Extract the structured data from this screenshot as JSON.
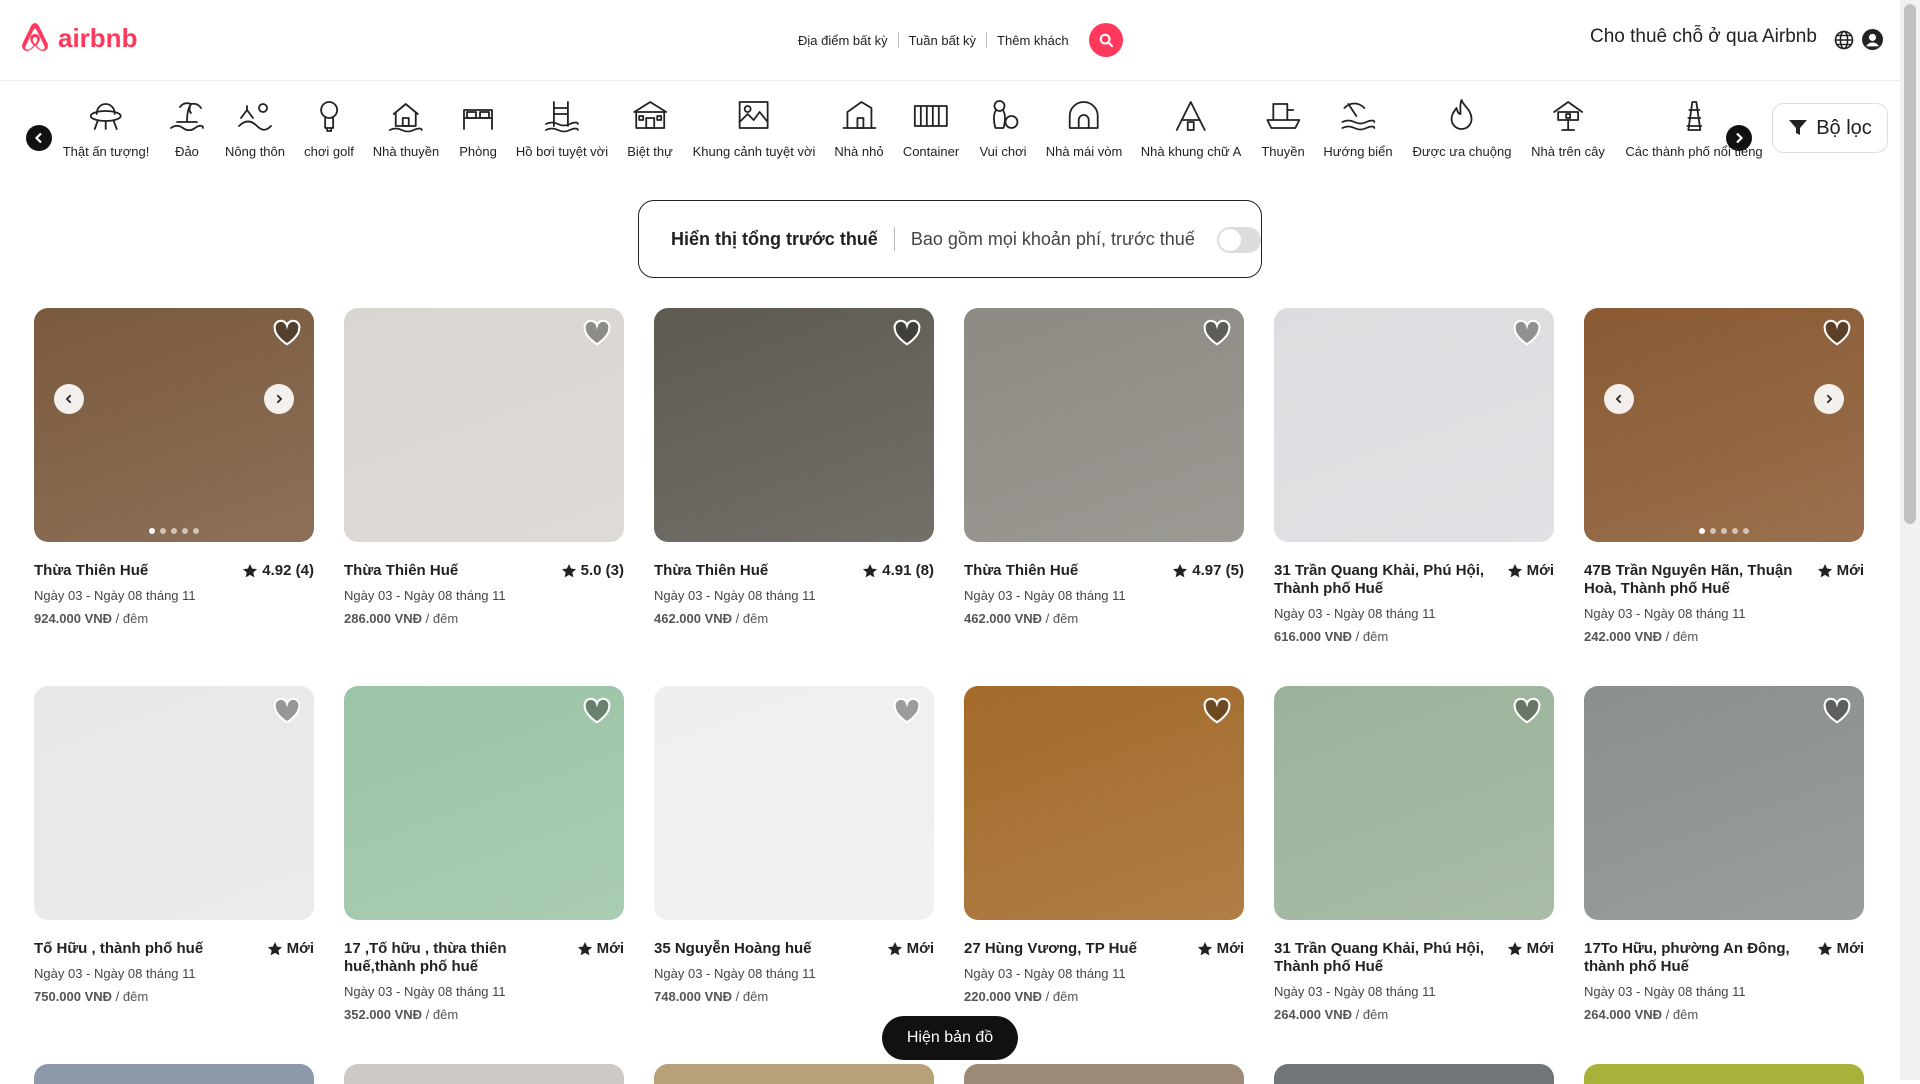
{
  "header": {
    "logo": "airbnb",
    "search": {
      "where": "Địa điểm bất kỳ",
      "when": "Tuần bất kỳ",
      "who": "Thêm khách"
    },
    "host_link": "Cho thuê chỗ ở qua Airbnb",
    "brand_color": "#ff385c"
  },
  "categories": [
    {
      "label": "Thật ấn tượng!",
      "icon": "ufo-icon"
    },
    {
      "label": "Đảo",
      "icon": "island-icon"
    },
    {
      "label": "Nông thôn",
      "icon": "countryside-icon"
    },
    {
      "label": "chơi golf",
      "icon": "golf-icon"
    },
    {
      "label": "Nhà thuyền",
      "icon": "houseboat-icon"
    },
    {
      "label": "Phòng",
      "icon": "room-icon"
    },
    {
      "label": "Hồ bơi tuyệt vời",
      "icon": "pool-icon"
    },
    {
      "label": "Biệt thự",
      "icon": "villa-icon"
    },
    {
      "label": "Khung cảnh tuyệt vời",
      "icon": "view-icon"
    },
    {
      "label": "Nhà nhỏ",
      "icon": "tiny-home-icon"
    },
    {
      "label": "Container",
      "icon": "container-icon"
    },
    {
      "label": "Vui chơi",
      "icon": "play-icon"
    },
    {
      "label": "Nhà mái vòm",
      "icon": "dome-icon"
    },
    {
      "label": "Nhà khung chữ A",
      "icon": "a-frame-icon"
    },
    {
      "label": "Thuyền",
      "icon": "boat-icon"
    },
    {
      "label": "Hướng biển",
      "icon": "beachfront-icon"
    },
    {
      "label": "Được ưa chuộng",
      "icon": "flame-icon"
    },
    {
      "label": "Nhà trên cây",
      "icon": "treehouse-icon"
    },
    {
      "label": "Các thành phố nổi tiếng",
      "icon": "tower-icon"
    }
  ],
  "filter_label": "Bộ lọc",
  "tax": {
    "title": "Hiển thị tổng trước thuế",
    "subtitle": "Bao gồm mọi khoản phí, trước thuế"
  },
  "listings": [
    {
      "title": "Thừa Thiên Huế",
      "rating": "4.92 (4)",
      "dates": "Ngày 03 - Ngày 08 tháng 11",
      "price": "924.000 VNĐ",
      "per": " / đêm",
      "color": "#7a5a3e"
    },
    {
      "title": "Thừa Thiên Huế",
      "rating": "5.0 (3)",
      "dates": "Ngày 03 - Ngày 08 tháng 11",
      "price": "286.000 VNĐ",
      "per": " / đêm",
      "color": "#d9d5d0"
    },
    {
      "title": "Thừa Thiên Huế",
      "rating": "4.91 (8)",
      "dates": "Ngày 03 - Ngày 08 tháng 11",
      "price": "462.000 VNĐ",
      "per": " / đêm",
      "color": "#5e5a52"
    },
    {
      "title": "Thừa Thiên Huế",
      "rating": "4.97 (5)",
      "dates": "Ngày 03 - Ngày 08 tháng 11",
      "price": "462.000 VNĐ",
      "per": " / đêm",
      "color": "#8d8a83"
    },
    {
      "title": "31 Trần Quang Khải, Phú Hội, Thành phố Huế",
      "rating": "Mới",
      "dates": "Ngày 03 - Ngày 08 tháng 11",
      "price": "616.000 VNĐ",
      "per": " / đêm",
      "color": "#dcdde0"
    },
    {
      "title": "47B Trần Nguyên Hãn, Thuận Hoà, Thành phố Huế",
      "rating": "Mới",
      "dates": "Ngày 03 - Ngày 08 tháng 11",
      "price": "242.000 VNĐ",
      "per": " / đêm",
      "color": "#8a5a33"
    },
    {
      "title": "Tố Hữu , thành phố huế",
      "rating": "Mới",
      "dates": "Ngày 03 - Ngày 08 tháng 11",
      "price": "750.000 VNĐ",
      "per": " / đêm",
      "color": "#e8e8e6"
    },
    {
      "title": "17 ,Tố hữu , thừa thiên huế,thành phố huế",
      "rating": "Mới",
      "dates": "Ngày 03 - Ngày 08 tháng 11",
      "price": "352.000 VNĐ",
      "per": " / đêm",
      "color": "#9cc4a6"
    },
    {
      "title": "35 Nguyễn Hoàng huế",
      "rating": "Mới",
      "dates": "Ngày 03 - Ngày 08 tháng 11",
      "price": "748.000 VNĐ",
      "per": " / đêm",
      "color": "#f0efed"
    },
    {
      "title": "27 Hùng Vương, TP Huế",
      "rating": "Mới",
      "dates": "Ngày 03 - Ngày 08 tháng 11",
      "price": "220.000 VNĐ",
      "per": " / đêm",
      "color": "#a36a2a"
    },
    {
      "title": "31 Trần Quang Khải, Phú Hội, Thành phố Huế",
      "rating": "Mới",
      "dates": "Ngày 03 - Ngày 08 tháng 11",
      "price": "264.000 VNĐ",
      "per": " / đêm",
      "color": "#9bb29a"
    },
    {
      "title": "17To Hữu, phường An Đông, thành phố Huế",
      "rating": "Mới",
      "dates": "Ngày 03 - Ngày 08 tháng 11",
      "price": "264.000 VNĐ",
      "per": " / đêm",
      "color": "#8a8f8c"
    }
  ],
  "map_button": "Hiện bản đồ"
}
